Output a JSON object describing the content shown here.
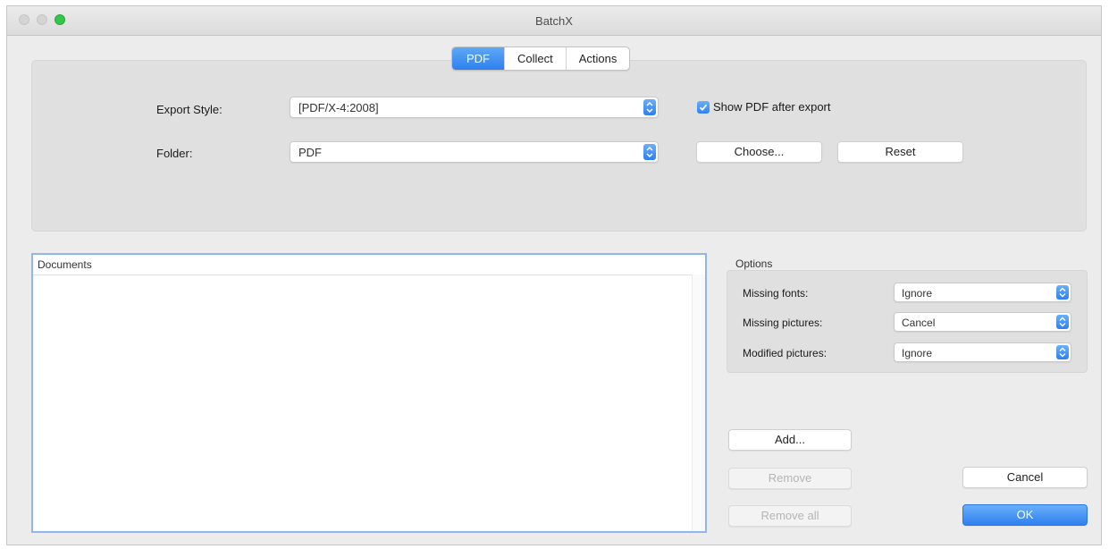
{
  "window": {
    "title": "BatchX"
  },
  "tabs": [
    {
      "label": "PDF",
      "active": true
    },
    {
      "label": "Collect",
      "active": false
    },
    {
      "label": "Actions",
      "active": false
    }
  ],
  "export": {
    "style_label": "Export Style:",
    "style_value": "[PDF/X-4:2008]",
    "folder_label": "Folder:",
    "folder_value": "PDF",
    "show_pdf_label": "Show PDF after export",
    "show_pdf_checked": true,
    "choose_label": "Choose...",
    "reset_label": "Reset"
  },
  "documents": {
    "header": "Documents",
    "items": []
  },
  "options": {
    "title": "Options",
    "rows": [
      {
        "label": "Missing fonts:",
        "value": "Ignore"
      },
      {
        "label": "Missing pictures:",
        "value": "Cancel"
      },
      {
        "label": "Modified pictures:",
        "value": "Ignore"
      }
    ]
  },
  "buttons": {
    "add": "Add...",
    "remove": "Remove",
    "remove_all": "Remove all",
    "cancel": "Cancel",
    "ok": "OK"
  },
  "colors": {
    "accent": "#2d80ef",
    "traffic_zoom": "#35c649"
  },
  "icons": [
    "updown-arrows-icon",
    "checkmark-icon"
  ]
}
